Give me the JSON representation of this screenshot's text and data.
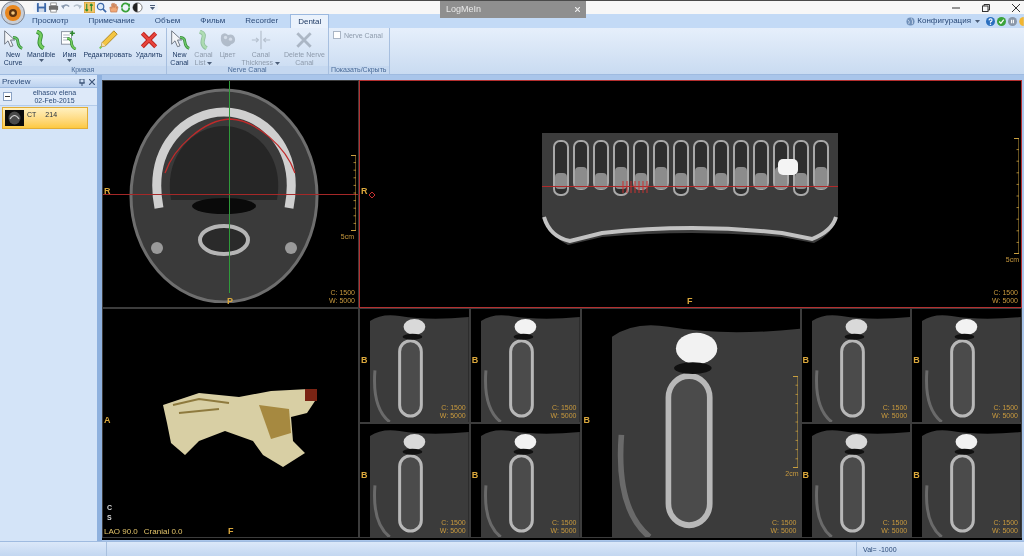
{
  "title_bar": {
    "notification": "LogMeIn"
  },
  "tabs": [
    {
      "label": "Просмотр",
      "selected": false
    },
    {
      "label": "Примечание",
      "selected": false
    },
    {
      "label": "Объем",
      "selected": false
    },
    {
      "label": "Фильм",
      "selected": false
    },
    {
      "label": "Recorder",
      "selected": false
    },
    {
      "label": "Dental",
      "selected": true
    }
  ],
  "config_menu": {
    "label": "Конфигурация"
  },
  "ribbon": {
    "groups": [
      {
        "label": "Кривая",
        "items": [
          {
            "kind": "button",
            "label": "New\nCurve",
            "dropdown": false,
            "disabled": false
          },
          {
            "kind": "button",
            "label": "Mandible",
            "dropdown": true,
            "disabled": false
          },
          {
            "kind": "button",
            "label": "Имя",
            "dropdown": true,
            "disabled": false
          },
          {
            "kind": "button",
            "label": "Редактировать",
            "dropdown": false,
            "disabled": false
          },
          {
            "kind": "button",
            "label": "Удалить",
            "dropdown": false,
            "disabled": false
          }
        ]
      },
      {
        "label": "Nerve Canal",
        "items": [
          {
            "kind": "button",
            "label": "New\nCanal",
            "dropdown": false,
            "disabled": false
          },
          {
            "kind": "button",
            "label": "Canal\nList",
            "dropdown": true,
            "disabled": true
          },
          {
            "kind": "button",
            "label": "Цвет",
            "dropdown": false,
            "disabled": true
          },
          {
            "kind": "button",
            "label": "Canal\nThickness",
            "dropdown": true,
            "disabled": true
          },
          {
            "kind": "button",
            "label": "Delete Nerve\nCanal",
            "dropdown": false,
            "disabled": true
          }
        ]
      },
      {
        "label": "Показать/Скрыть",
        "items": [
          {
            "kind": "checkbox",
            "label": "Nerve Canal",
            "checked": false,
            "disabled": true
          }
        ]
      }
    ]
  },
  "preview": {
    "title": "Preview",
    "patient": {
      "name": "elhasov elena",
      "date": "02-Feb-2015",
      "expanded": true
    },
    "series": [
      {
        "modality": "CT",
        "images": "214",
        "selected": true
      }
    ]
  },
  "top_row": [
    {
      "kind": "axial",
      "selected": false,
      "left_label": "R",
      "bottom_label": "P",
      "scale": "5cm",
      "center": "C: 1500",
      "width": "W: 5000"
    },
    {
      "kind": "panoramic",
      "selected": true,
      "left_label": "R",
      "bottom_label": "F",
      "scale": "5cm",
      "center": "C: 1500",
      "width": "W: 5000"
    }
  ],
  "bottom_row": [
    {
      "kind": "volume",
      "selected": false,
      "left_label": "A",
      "bottom_label": "F",
      "corner_labels": [
        "C",
        "S"
      ],
      "angles": [
        "LAO 90.0",
        "Cranial 0.0"
      ]
    },
    {
      "kind": "cross_section_grid",
      "panels": [
        {
          "selected": false,
          "side_label": "B",
          "center": "C: 1500",
          "width": "W: 5000"
        },
        {
          "selected": false,
          "side_label": "B",
          "center": "C: 1500",
          "width": "W: 5000"
        },
        {
          "selected": false,
          "side_label": "B",
          "center": "C: 1500",
          "width": "W: 5000"
        },
        {
          "selected": false,
          "side_label": "B",
          "center": "C: 1500",
          "width": "W: 5000"
        }
      ]
    },
    {
      "kind": "cross_section",
      "selected": false,
      "side_label": "B",
      "scale": "2cm",
      "center": "C: 1500",
      "width": "W: 5000"
    },
    {
      "kind": "cross_section_grid",
      "panels": [
        {
          "selected": false,
          "side_label": "B",
          "center": "C: 1500",
          "width": "W: 5000"
        },
        {
          "selected": false,
          "side_label": "B",
          "center": "C: 1500",
          "width": "W: 5000"
        },
        {
          "selected": false,
          "side_label": "B",
          "center": "C: 1500",
          "width": "W: 5000"
        },
        {
          "selected": false,
          "side_label": "B",
          "center": "C: 1500",
          "width": "W: 5000"
        }
      ]
    }
  ],
  "status_bar": {
    "value": "Val= -1000"
  }
}
